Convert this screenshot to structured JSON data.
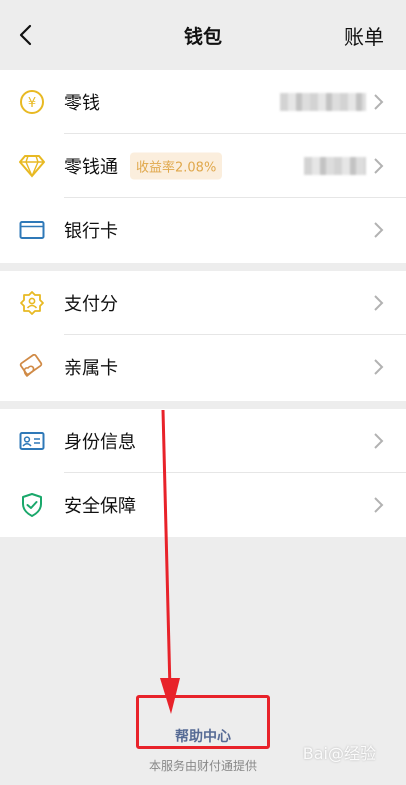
{
  "nav": {
    "title": "钱包",
    "bill_label": "账单"
  },
  "groups": [
    {
      "items": [
        {
          "label": "零钱",
          "icon": "yuan-coin-icon"
        },
        {
          "label": "零钱通",
          "icon": "diamond-icon",
          "badge": "收益率2.08%"
        },
        {
          "label": "银行卡",
          "icon": "bank-card-icon"
        }
      ]
    },
    {
      "items": [
        {
          "label": "支付分",
          "icon": "pay-score-icon"
        },
        {
          "label": "亲属卡",
          "icon": "family-card-icon"
        }
      ]
    },
    {
      "items": [
        {
          "label": "身份信息",
          "icon": "id-card-icon"
        },
        {
          "label": "安全保障",
          "icon": "shield-check-icon"
        }
      ]
    }
  ],
  "footer": {
    "help_label": "帮助中心",
    "provider_text": "本服务由财付通提供"
  },
  "watermark": "Bai@经验",
  "colors": {
    "accent_link": "#576b95",
    "badge_text": "#e0a84c",
    "badge_bg": "#fbeedd",
    "annotation_red": "#e8222a",
    "icon_yellow": "#e8b923",
    "icon_blue": "#2f79b8",
    "icon_green": "#1aa86b",
    "icon_orange": "#d08a46"
  }
}
